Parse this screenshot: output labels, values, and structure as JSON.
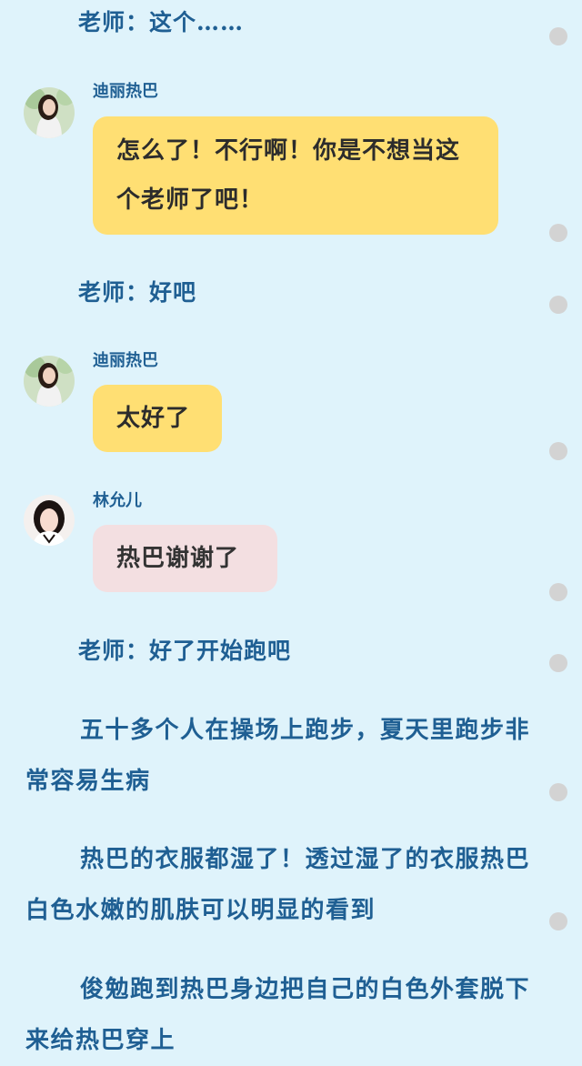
{
  "speakers": {
    "dilireba": "迪丽热巴",
    "linyuner": "林允儿"
  },
  "messages": {
    "narr1": "老师：这个……",
    "bubble1": "怎么了！不行啊！你是不想当这个老师了吧！",
    "narr2": "老师：好吧",
    "bubble2": "太好了",
    "bubble3": "热巴谢谢了",
    "narr3": "老师：好了开始跑吧"
  },
  "paragraphs": {
    "p1": "五十多个人在操场上跑步，夏天里跑步非常容易生病",
    "p2": "热巴的衣服都湿了！透过湿了的衣服热巴白色水嫩的肌肤可以明显的看到",
    "p3": "俊勉跑到热巴身边把自己的白色外套脱下来给热巴穿上"
  },
  "colors": {
    "background": "#dff3fb",
    "narration_text": "#1f5f93",
    "bubble_yellow": "#ffdf73",
    "bubble_pink": "#f3dfe1",
    "scroll_dot": "#d3d3d3"
  }
}
